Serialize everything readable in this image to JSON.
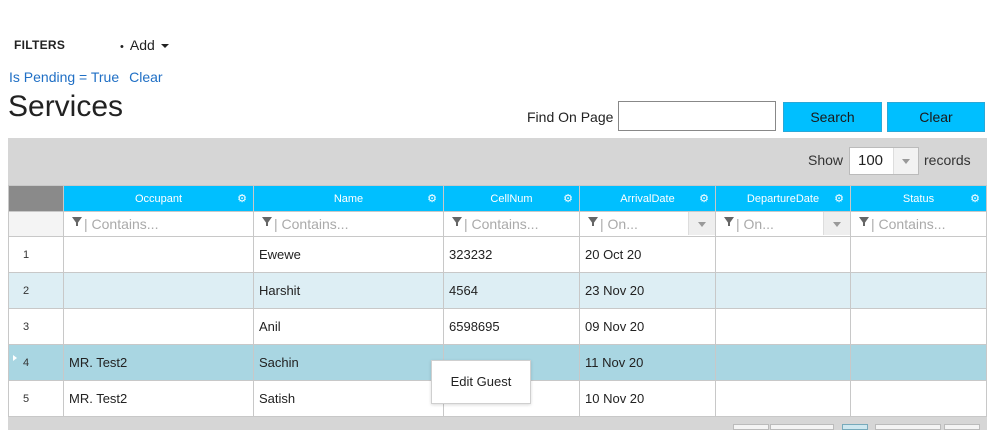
{
  "filters": {
    "title": "FILTERS",
    "add_bullet": "•",
    "add_label": "Add",
    "active_filter": "Is Pending = True",
    "clear_label": "Clear"
  },
  "page": {
    "title": "Services"
  },
  "search": {
    "label": "Find On Page",
    "value": "",
    "placeholder": "",
    "search_button": "Search",
    "clear_button": "Clear"
  },
  "grid": {
    "show_label": "Show",
    "page_size": "100",
    "records_label": "records",
    "columns": [
      {
        "label": "Occupant",
        "filter_placeholder": "Contains..."
      },
      {
        "label": "Name",
        "filter_placeholder": "Contains..."
      },
      {
        "label": "CellNum",
        "filter_placeholder": "Contains..."
      },
      {
        "label": "ArrivalDate",
        "filter_placeholder": "On..."
      },
      {
        "label": "DepartureDate",
        "filter_placeholder": "On..."
      },
      {
        "label": "Status",
        "filter_placeholder": "Contains..."
      }
    ],
    "rows": [
      {
        "num": "1",
        "occupant": "",
        "name": "Ewewe",
        "cellnum": "323232",
        "arrival": "20 Oct 20",
        "departure": "",
        "status": ""
      },
      {
        "num": "2",
        "occupant": "",
        "name": "Harshit",
        "cellnum": "4564",
        "arrival": "23 Nov 20",
        "departure": "",
        "status": ""
      },
      {
        "num": "3",
        "occupant": "",
        "name": "Anil",
        "cellnum": "6598695",
        "arrival": "09 Nov 20",
        "departure": "",
        "status": ""
      },
      {
        "num": "4",
        "occupant": "MR. Test2",
        "name": "Sachin",
        "cellnum": "",
        "arrival": "11 Nov 20",
        "departure": "",
        "status": ""
      },
      {
        "num": "5",
        "occupant": "MR. Test2",
        "name": "Satish",
        "cellnum": "",
        "arrival": "10 Nov 20",
        "departure": "",
        "status": ""
      }
    ]
  },
  "context_menu": {
    "items": [
      "Edit Guest"
    ]
  },
  "icons": {
    "header": "gear-icon",
    "filter": "funnel-icon"
  },
  "colors": {
    "accent": "#00bfff",
    "link": "#1f6fc5",
    "row_alt": "#ddeef4",
    "row_selected": "#a9d6e2"
  }
}
